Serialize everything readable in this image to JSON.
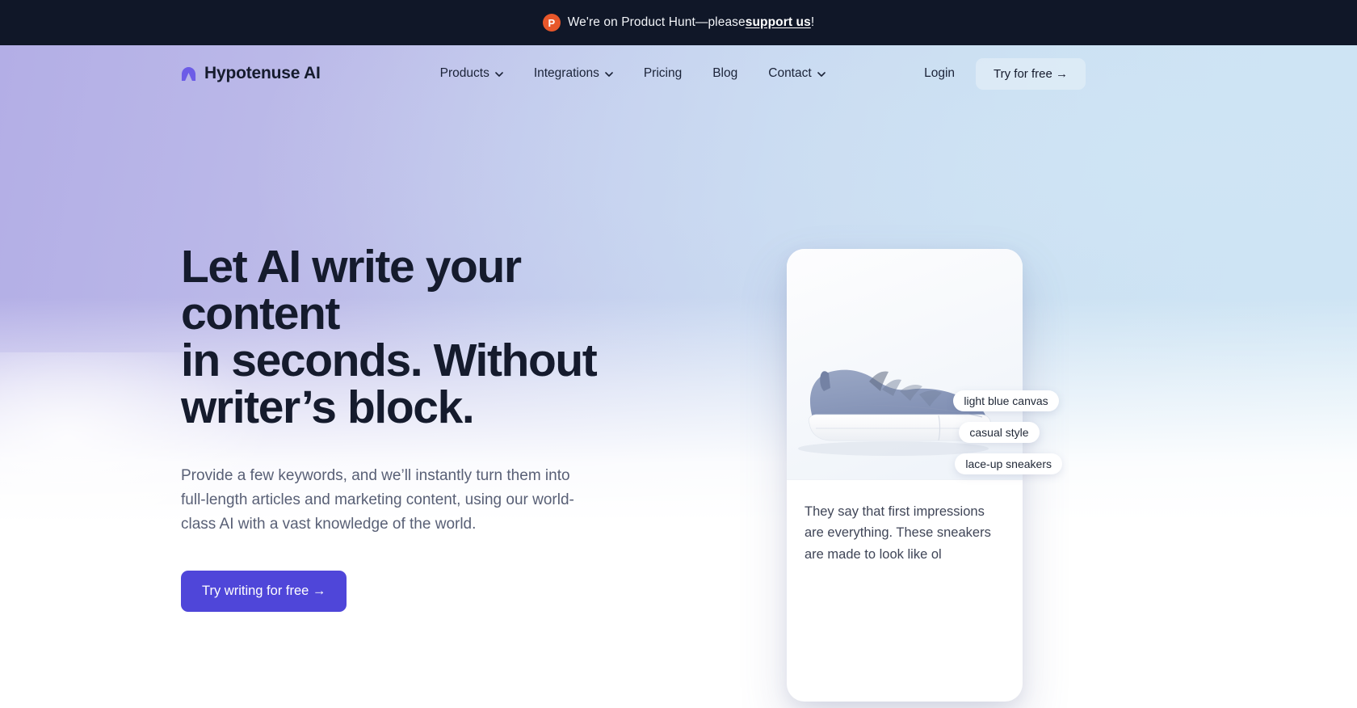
{
  "banner": {
    "icon": "product-hunt-icon",
    "icon_letter": "P",
    "text_before": "We're on Product Hunt—please",
    "link_text": "support us",
    "text_after": "!"
  },
  "nav": {
    "logo_text": "Hypotenuse AI",
    "links": [
      {
        "label": "Products",
        "has_dropdown": true
      },
      {
        "label": "Integrations",
        "has_dropdown": true
      },
      {
        "label": "Pricing",
        "has_dropdown": false
      },
      {
        "label": "Blog",
        "has_dropdown": false
      },
      {
        "label": "Contact",
        "has_dropdown": true
      }
    ],
    "login_label": "Login",
    "cta_label": "Try for free →"
  },
  "hero": {
    "headline": "Let AI write your content\nin seconds. Without\nwriter’s block.",
    "subtext": "Provide a few keywords, and we’ll instantly turn them into\nfull-length articles and marketing content, using our world-\nclass AI with a vast knowledge of the world.",
    "cta_label": "Try writing for free →"
  },
  "product_card": {
    "image_alt": "light-blue-canvas-sneaker",
    "tags": [
      "light blue canvas",
      "casual style",
      "lace-up sneakers"
    ],
    "generated_text": "They say that first impressions\nare everything. These sneakers\nare made to look like ol"
  },
  "colors": {
    "banner_bg": "#101728",
    "product_hunt": "#e8572a",
    "brand_purple": "#6c5ce7",
    "cta_indigo": "#4f46d9",
    "heading": "#151b2d",
    "body_text": "#596076",
    "gradient_left": "#b3aee6",
    "gradient_right": "#cfe7f5"
  }
}
